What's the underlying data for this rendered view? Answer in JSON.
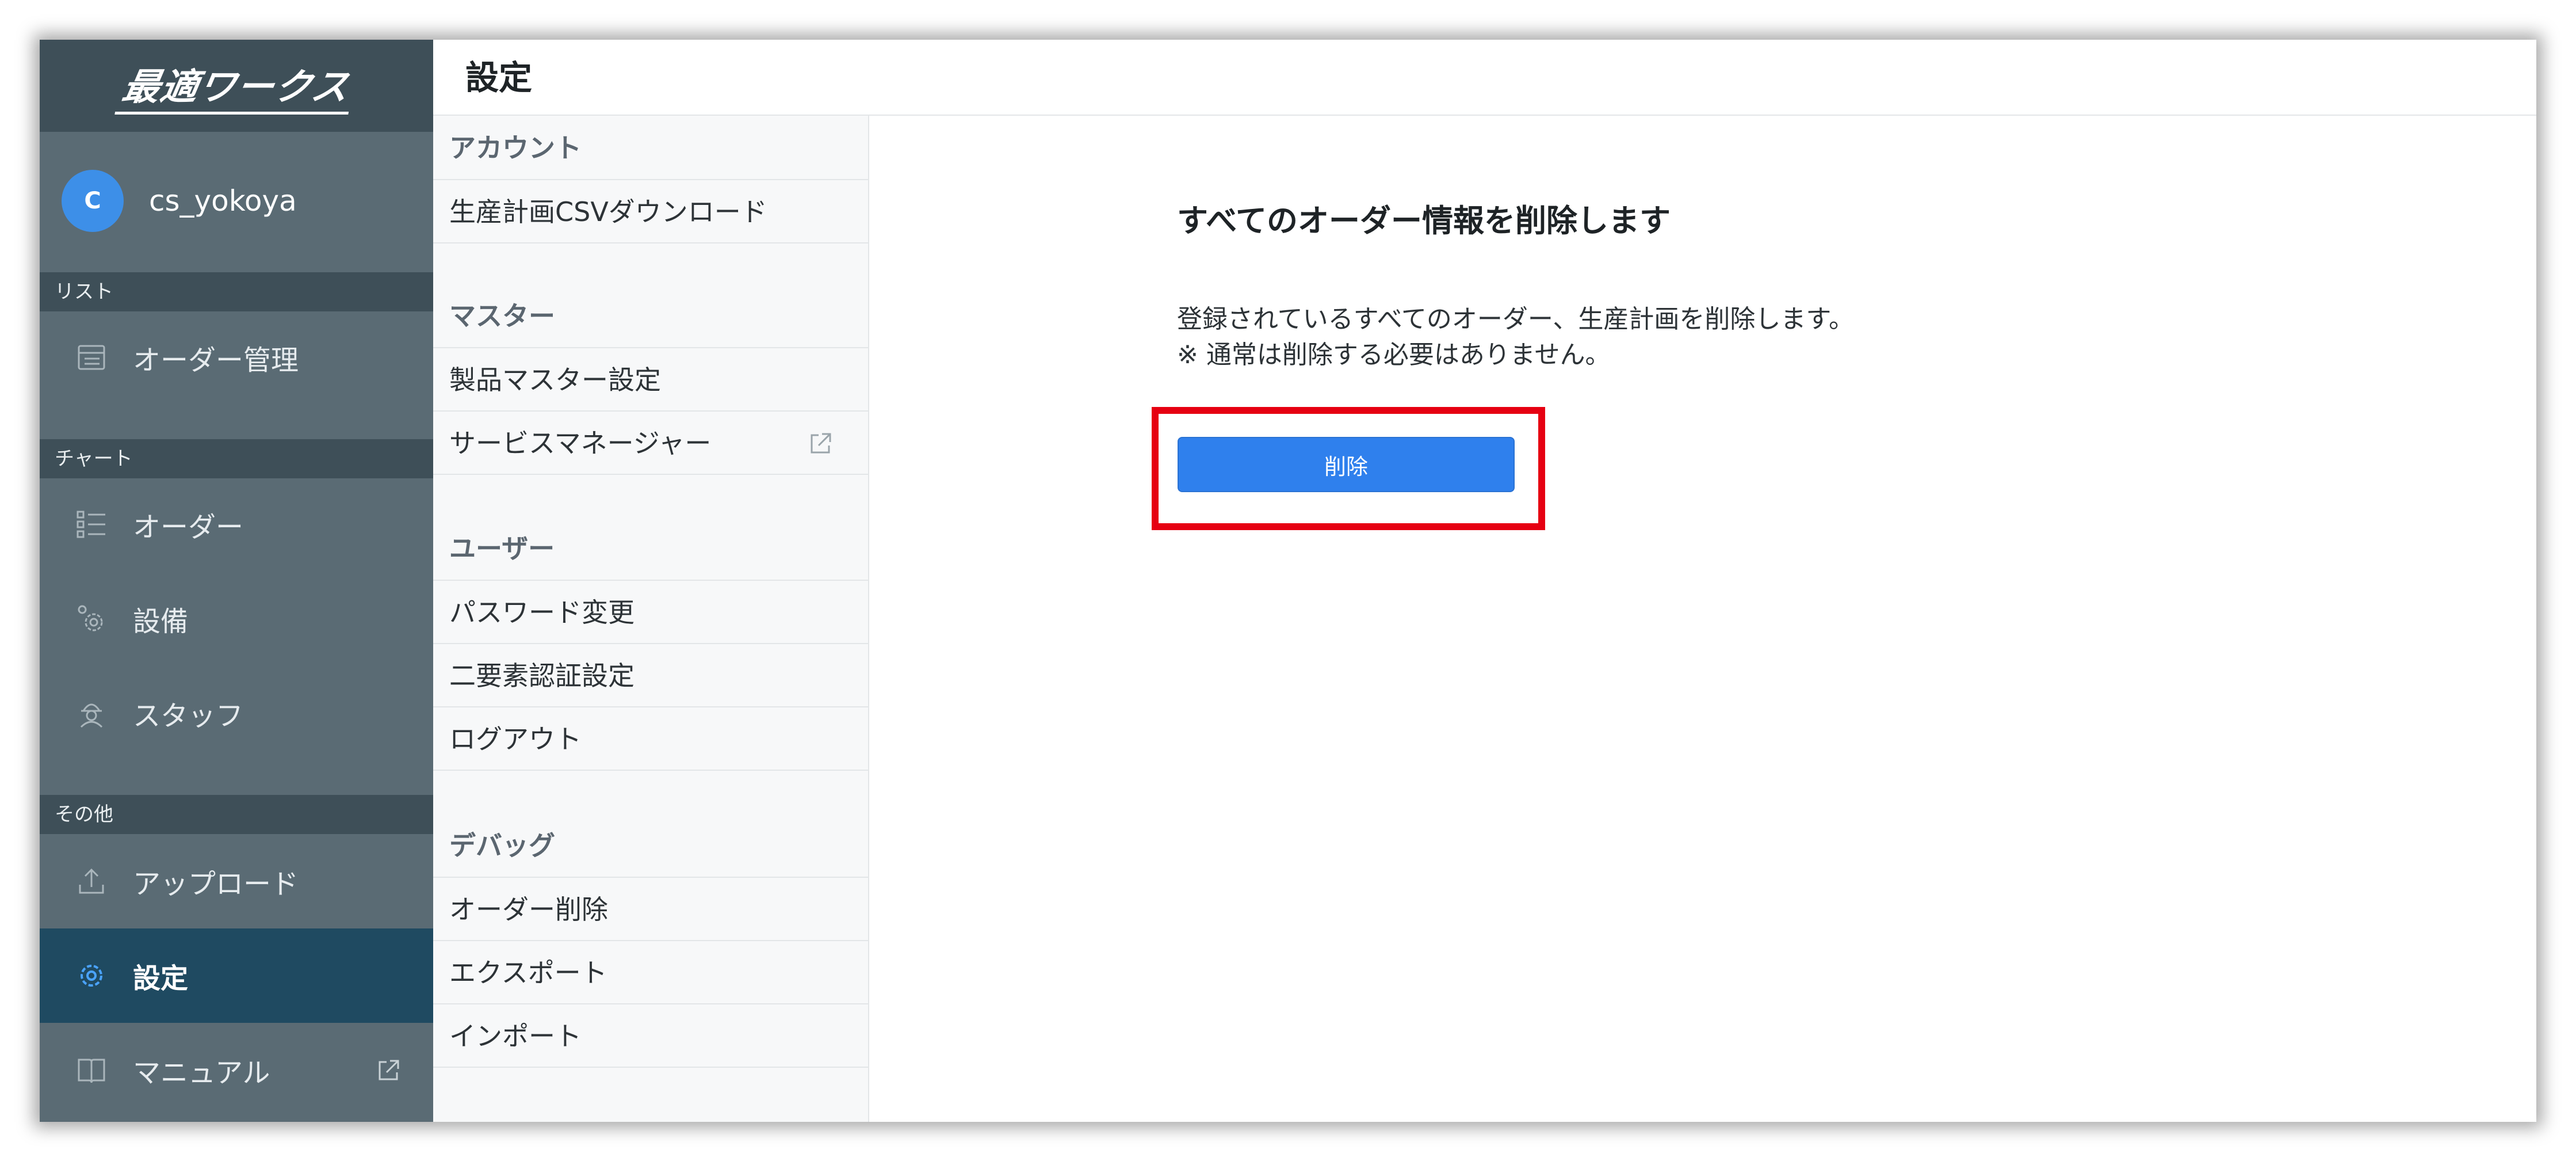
{
  "app": {
    "logo_text": "最適ワークス"
  },
  "user": {
    "avatar_initial": "C",
    "name": "cs_yokoya"
  },
  "sidebar": {
    "sections": [
      {
        "label": "リスト"
      },
      {
        "label": "チャート"
      },
      {
        "label": "その他"
      }
    ],
    "items": [
      {
        "label": "オーダー管理",
        "icon": "list-table-icon"
      },
      {
        "label": "オーダー",
        "icon": "list-icon"
      },
      {
        "label": "設備",
        "icon": "equipment-gear-icon"
      },
      {
        "label": "スタッフ",
        "icon": "staff-icon"
      },
      {
        "label": "アップロード",
        "icon": "upload-icon"
      },
      {
        "label": "設定",
        "icon": "gear-icon",
        "active": true
      },
      {
        "label": "マニュアル",
        "icon": "book-icon",
        "external": true
      }
    ]
  },
  "header": {
    "title": "設定"
  },
  "menu": {
    "groups": [
      {
        "label": "アカウント",
        "items": [
          {
            "label": "生産計画CSVダウンロード"
          }
        ]
      },
      {
        "label": "マスター",
        "items": [
          {
            "label": "製品マスター設定"
          },
          {
            "label": "サービスマネージャー",
            "external": true
          }
        ]
      },
      {
        "label": "ユーザー",
        "items": [
          {
            "label": "パスワード変更"
          },
          {
            "label": "二要素認証設定"
          },
          {
            "label": "ログアウト"
          }
        ]
      },
      {
        "label": "デバッグ",
        "items": [
          {
            "label": "オーダー削除"
          },
          {
            "label": "エクスポート"
          },
          {
            "label": "インポート"
          }
        ]
      }
    ]
  },
  "main": {
    "title": "すべてのオーダー情報を削除します",
    "description_line1": "登録されているすべてのオーダー、生産計画を削除します。",
    "description_line2": "※ 通常は削除する必要はありません。",
    "delete_button_label": "削除"
  },
  "colors": {
    "sidebar_bg": "#5a6b74",
    "sidebar_dark": "#3e4f58",
    "active_item_bg": "#1f4a61",
    "primary_button": "#2f80ed",
    "highlight_border": "#e60012",
    "avatar_bg": "#3d8fe8"
  }
}
